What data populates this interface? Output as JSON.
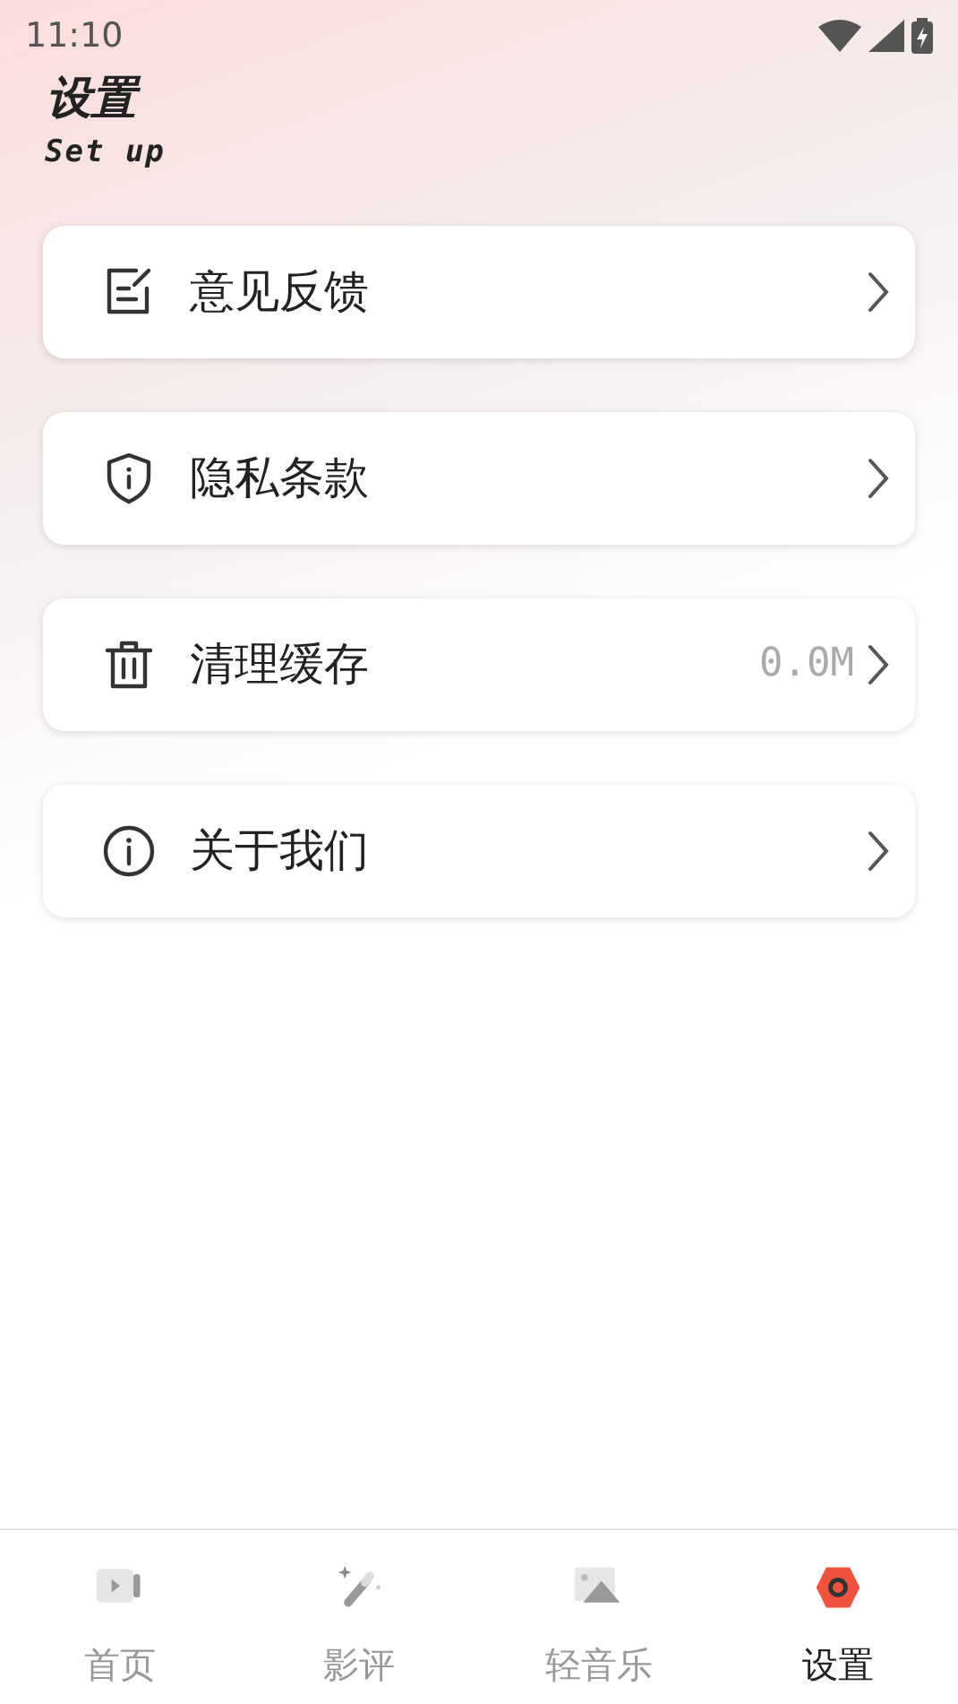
{
  "status_bar": {
    "time": "11:10"
  },
  "header": {
    "title": "设置",
    "subtitle": "Set up"
  },
  "settings": [
    {
      "kind": "feedback",
      "label": "意见反馈"
    },
    {
      "kind": "privacy",
      "label": "隐私条款"
    },
    {
      "kind": "cache",
      "label": "清理缓存",
      "value": "0.0M"
    },
    {
      "kind": "about",
      "label": "关于我们"
    }
  ],
  "tab_bar": [
    {
      "kind": "video",
      "label": "首页",
      "selected": false
    },
    {
      "kind": "wand",
      "label": "影评",
      "selected": false
    },
    {
      "kind": "image",
      "label": "轻音乐",
      "selected": false
    },
    {
      "kind": "gear",
      "label": "设置",
      "selected": true
    }
  ]
}
